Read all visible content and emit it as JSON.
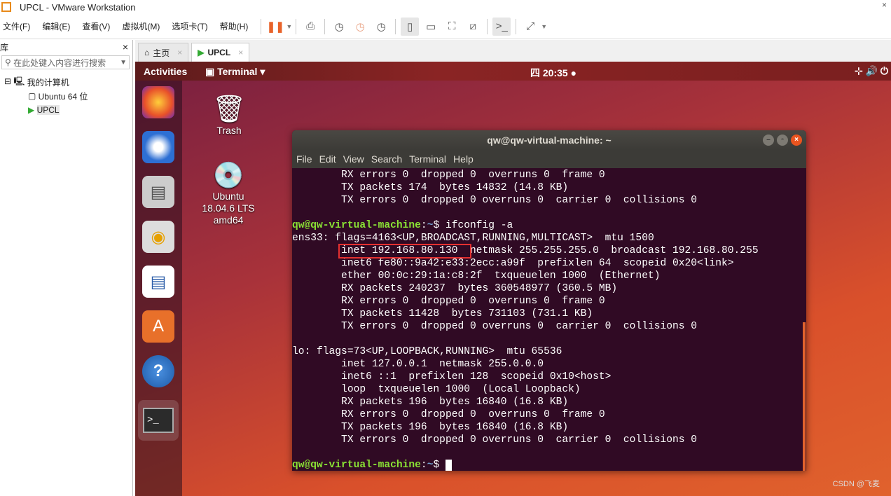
{
  "window": {
    "title": "UPCL - VMware Workstation"
  },
  "menubar": {
    "items": [
      "文件(F)",
      "编辑(E)",
      "查看(V)",
      "虚拟机(M)",
      "选项卡(T)",
      "帮助(H)"
    ]
  },
  "library": {
    "title": "库",
    "close": "×",
    "search_placeholder": "在此处键入内容进行搜索",
    "tree": [
      "我的计算机",
      "Ubuntu 64 位",
      "UPCL"
    ]
  },
  "tabs": [
    {
      "label": "主页"
    },
    {
      "label": "UPCL"
    }
  ],
  "ubuntu": {
    "activities": "Activities",
    "app": "Terminal ▾",
    "clock": "四 20:35 ●"
  },
  "desktop": {
    "trash": "Trash",
    "dvd": "Ubuntu\n18.04.6 LTS\namd64"
  },
  "terminal": {
    "title": "qw@qw-virtual-machine: ~",
    "menu": [
      "File",
      "Edit",
      "View",
      "Search",
      "Terminal",
      "Help"
    ],
    "prompt_user": "qw@qw-virtual-machine",
    "prompt_path": "~",
    "lines": [
      "        RX errors 0  dropped 0  overruns 0  frame 0",
      "        TX packets 174  bytes 14832 (14.8 KB)",
      "        TX errors 0  dropped 0 overruns 0  carrier 0  collisions 0",
      "",
      {
        "prompt": true,
        "cmd": "ifconfig -a"
      },
      "ens33: flags=4163<UP,BROADCAST,RUNNING,MULTICAST>  mtu 1500",
      "        inet 192.168.80.130  netmask 255.255.255.0  broadcast 192.168.80.255",
      "        inet6 fe80::9a42:e33:2ecc:a99f  prefixlen 64  scopeid 0x20<link>",
      "        ether 00:0c:29:1a:c8:2f  txqueuelen 1000  (Ethernet)",
      "        RX packets 240237  bytes 360548977 (360.5 MB)",
      "        RX errors 0  dropped 0  overruns 0  frame 0",
      "        TX packets 11428  bytes 731103 (731.1 KB)",
      "        TX errors 0  dropped 0 overruns 0  carrier 0  collisions 0",
      "",
      "lo: flags=73<UP,LOOPBACK,RUNNING>  mtu 65536",
      "        inet 127.0.0.1  netmask 255.0.0.0",
      "        inet6 ::1  prefixlen 128  scopeid 0x10<host>",
      "        loop  txqueuelen 1000  (Local Loopback)",
      "        RX packets 196  bytes 16840 (16.8 KB)",
      "        RX errors 0  dropped 0  overruns 0  frame 0",
      "        TX packets 196  bytes 16840 (16.8 KB)",
      "        TX errors 0  dropped 0 overruns 0  carrier 0  collisions 0",
      "",
      {
        "prompt": true,
        "cmd": "",
        "cursor": true
      }
    ]
  },
  "highlight_color": "#e53030",
  "watermark": "CSDN @飞麦"
}
